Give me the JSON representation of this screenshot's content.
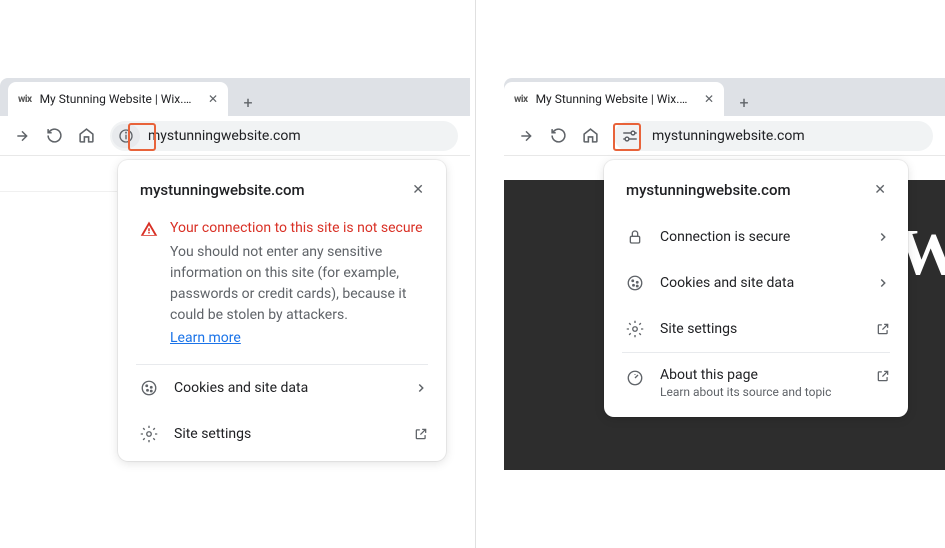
{
  "left": {
    "tab": {
      "favicon": "wix",
      "title": "My Stunning Website | Wix.com"
    },
    "url": "mystunningwebsite.com",
    "popup": {
      "domain": "mystunningwebsite.com",
      "warning_title": "Your connection to this site is not secure",
      "warning_desc": "You should not enter any sensitive information on this site (for example, passwords or credit cards), because it could be stolen by attackers.",
      "learn_more": "Learn more",
      "cookies_label": "Cookies and site data",
      "settings_label": "Site settings"
    }
  },
  "right": {
    "tab": {
      "favicon": "wix",
      "title": "My Stunning Website | Wix.com"
    },
    "url": "mystunningwebsite.com",
    "popup": {
      "domain": "mystunningwebsite.com",
      "secure_label": "Connection is secure",
      "cookies_label": "Cookies and site data",
      "settings_label": "Site settings",
      "about_label": "About this page",
      "about_sub": "Learn about its source and topic"
    }
  }
}
